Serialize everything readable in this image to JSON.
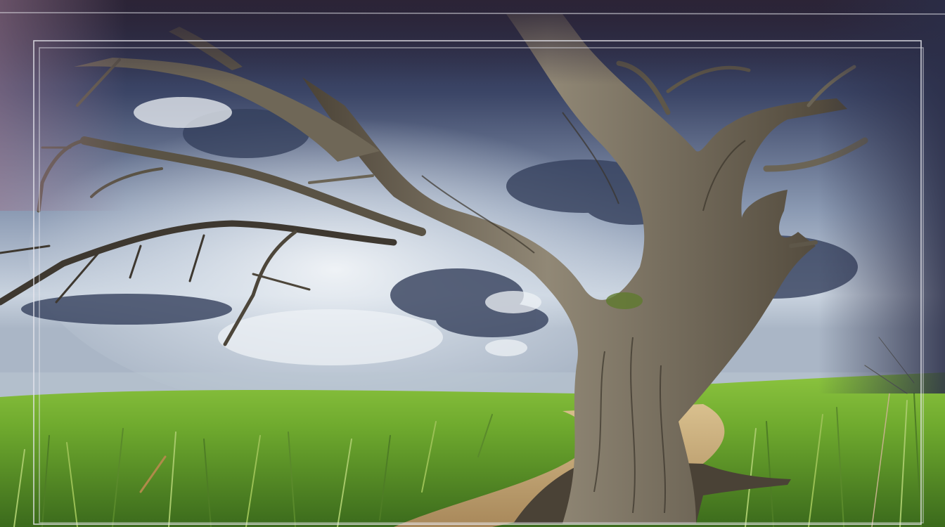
{
  "image": {
    "subject": "tree",
    "icon": "tree-icon"
  },
  "colors": {
    "sky_dark": "#2a2b48",
    "sky_mid": "#5d6f8f",
    "sky_light": "#dfe6ee",
    "cloud_shadow": "#3f4c68",
    "grass_bright": "#7fb83a",
    "grass_dark": "#3f6a1f",
    "path": "#c8ab7a",
    "bark_light": "#8a8170",
    "bark_dark": "#3d362c",
    "frame_line": "#e8e8ee",
    "vignette": "#2e2538"
  }
}
